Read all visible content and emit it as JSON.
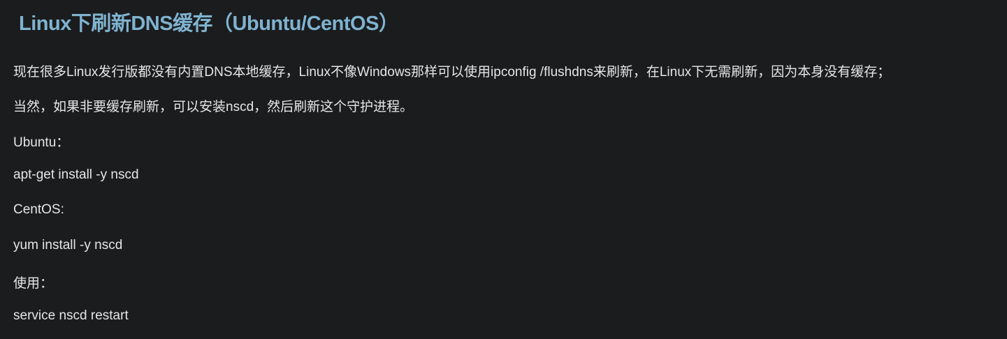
{
  "article": {
    "title": "Linux下刷新DNS缓存（Ubuntu/CentOS）",
    "paragraphs": [
      "现在很多Linux发行版都没有内置DNS本地缓存，Linux不像Windows那样可以使用ipconfig /flushdns来刷新，在Linux下无需刷新，因为本身没有缓存；",
      "当然，如果非要缓存刷新，可以安装nscd，然后刷新这个守护进程。",
      "Ubuntu：",
      "apt-get install -y nscd",
      "CentOS:",
      "yum install -y nscd",
      "使用：",
      "service nscd restart"
    ]
  }
}
